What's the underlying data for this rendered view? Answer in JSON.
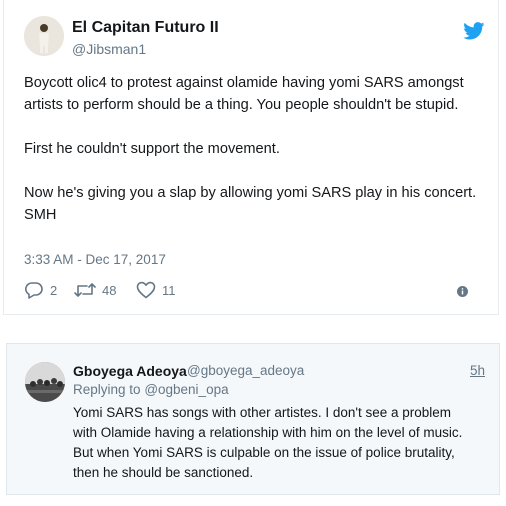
{
  "tweet": {
    "name": "El Capitan Futuro II",
    "handle": "@Jibsman1",
    "paragraphs": [
      "Boycott olic4 to protest against olamide having yomi SARS amongst artists to perform should be a thing. You people shouldn't be stupid.",
      "First he couldn't support the movement.",
      "Now he's giving you a slap by allowing yomi SARS play in his concert. SMH"
    ],
    "timestamp": "3:33 AM - Dec 17, 2017",
    "replies": "2",
    "retweets": "48",
    "likes": "11",
    "icons": [
      "reply-icon",
      "retweet-icon",
      "like-icon",
      "info-icon",
      "twitter-bird-icon"
    ],
    "accent": "#1da1f2"
  },
  "reply": {
    "name": "Gboyega Adeoya",
    "handle": "@gboyega_adeoya",
    "time": "5h",
    "replying_prefix": "Replying to",
    "replying_to": "@ogbeni_opa",
    "lines": [
      "Yomi SARS has songs with other artistes. I don't see a problem",
      "with Olamide having a relationship with him on the level of music.",
      "But when Yomi SARS is culpable on the issue of police brutality,",
      "then he should be sanctioned."
    ]
  }
}
